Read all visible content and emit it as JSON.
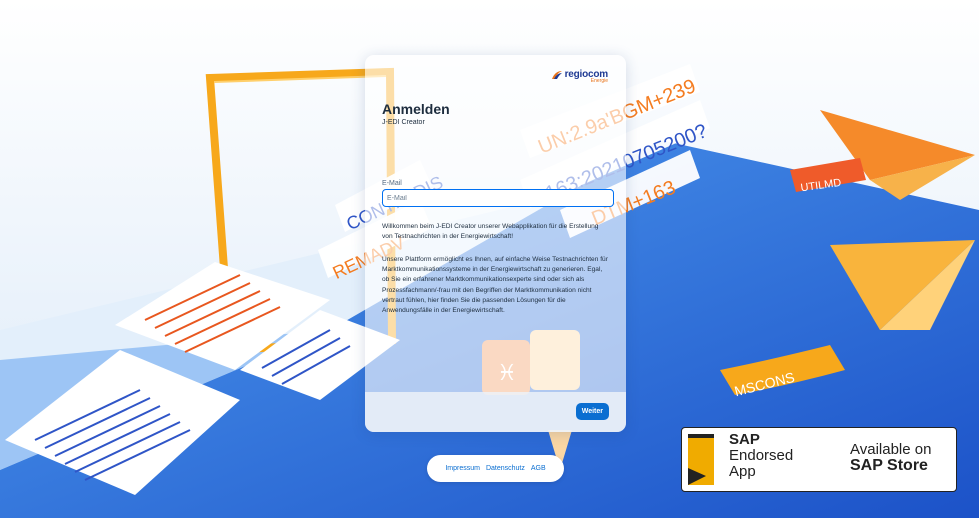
{
  "logo": {
    "name": "regiocom",
    "sub": "Energie"
  },
  "login": {
    "title": "Anmelden",
    "subtitle": "J-EDI Creator",
    "email_label": "E-Mail",
    "email_placeholder": "E-Mail",
    "email_value": "",
    "intro": "Willkommen beim J-EDI Creator unserer Webapplikation für die Erstellung von Testnachrichten in der Energiewirtschaft!",
    "body": "Unsere Plattform ermöglicht es Ihnen, auf einfache Weise Testnachrichten für Marktkommunikationssysteme in der Energiewirtschaft zu generieren. Egal, ob Sie ein erfahrener Marktkommunikationsexperte sind oder sich als Prozessfachmann/-frau mit den Begriffen der Marktkommunikation nicht vertraut fühlen, hier finden Sie die passenden Lösungen für die Anwendungsfälle in der Energiewirtschaft.",
    "next_button": "Weiter"
  },
  "footer": {
    "impressum": "Impressum",
    "datenschutz": "Datenschutz",
    "agb": "AGB"
  },
  "background": {
    "strips": [
      "UN:2.9a'BGM+239",
      "163:20210705200?",
      "DTM+163",
      "CONTRLDIS",
      "REMADV"
    ],
    "plane_labels": [
      "UTILMD",
      "MSCONS"
    ]
  },
  "sap_badge": {
    "line1": "SAP",
    "line2": "Endorsed",
    "line3": "App",
    "right1": "Available on",
    "right2": "SAP Store"
  },
  "colors": {
    "primary": "#0a6ed1",
    "accent": "#f39c12",
    "plane": "#f47c20"
  }
}
